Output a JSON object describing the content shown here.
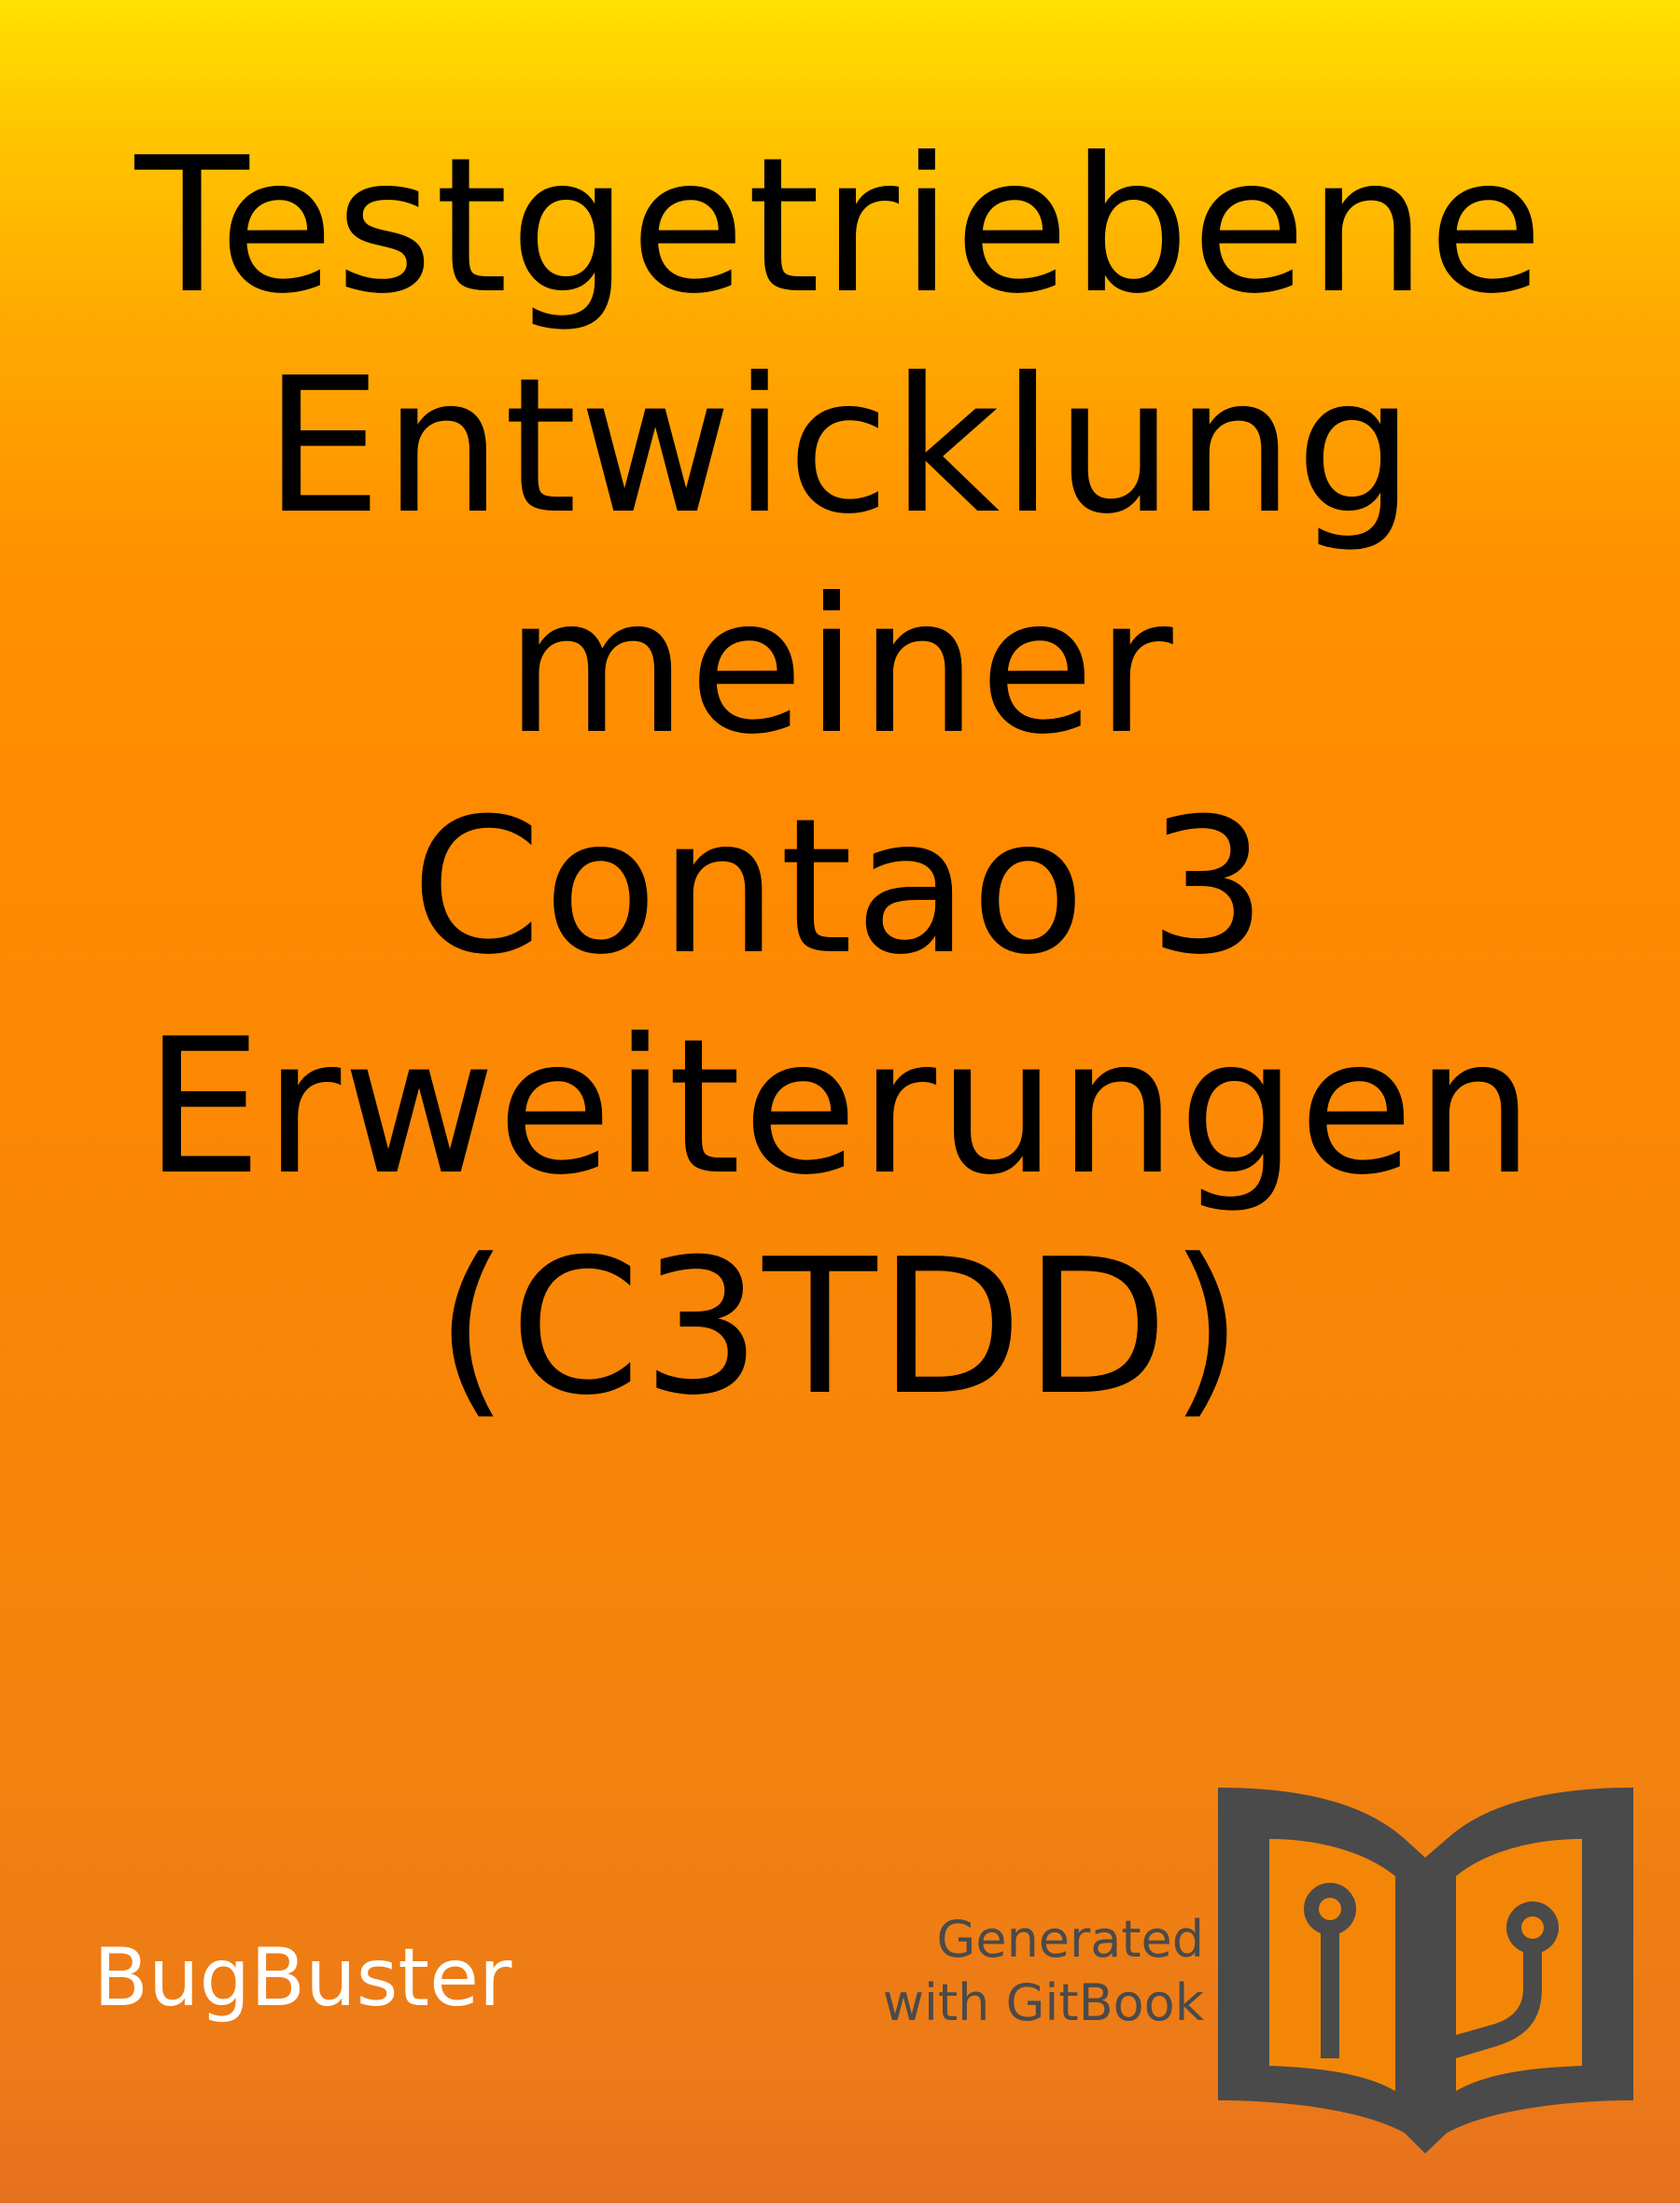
{
  "cover": {
    "title_lines": [
      "Testgetriebene",
      "Entwicklung",
      "meiner",
      "Contao 3",
      "Erweiterungen",
      "(C3TDD)"
    ],
    "author": "BugBuster",
    "generator_lines": [
      "Generated",
      "with GitBook"
    ],
    "logo_icon": "gitbook-book-icon"
  },
  "colors": {
    "background_top": "#ffe100",
    "background_middle": "#ff8a00",
    "background_bottom": "#e5711f",
    "title_text": "#000000",
    "author_text": "#ffffff",
    "logo_and_generator": "#4a4a4a"
  }
}
